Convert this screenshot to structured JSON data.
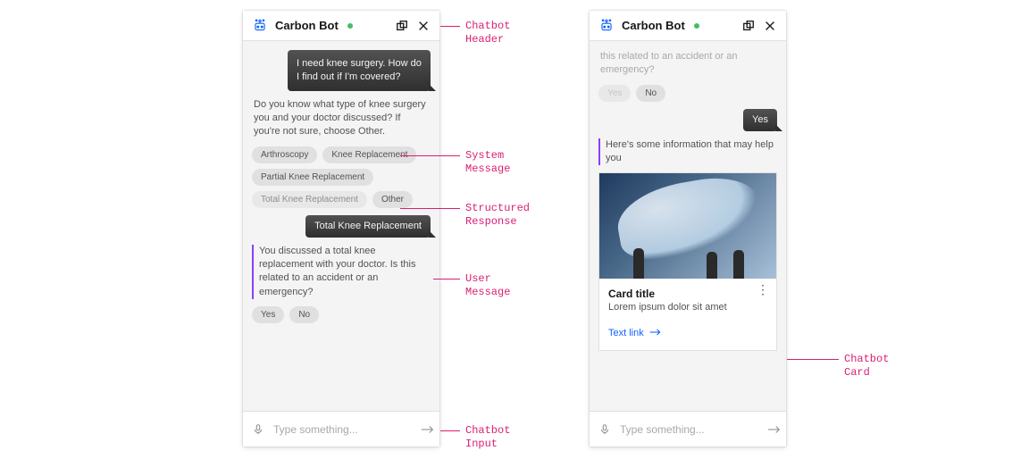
{
  "header": {
    "title": "Carbon Bot"
  },
  "left": {
    "user1": "I need knee surgery. How do I find out if I'm covered?",
    "sys1": "Do you know what type of knee surgery you and your doctor discussed? If you're not sure, choose Other.",
    "chips": {
      "c0": "Arthroscopy",
      "c1": "Knee Replacement",
      "c2": "Partial Knee Replacement",
      "c3": "Total Knee Replacement",
      "c4": "Other"
    },
    "user2": "Total Knee Replacement",
    "sys2": "You discussed a total knee replacement with your doctor. Is this related to an accident or an emergency?",
    "yn": {
      "yes": "Yes",
      "no": "No"
    }
  },
  "right": {
    "faded_tail": "this related to an accident or an emergency?",
    "yn": {
      "yes": "Yes",
      "no": "No"
    },
    "user_yes": "Yes",
    "sys": "Here's some information that may help you",
    "card": {
      "title": "Card title",
      "subtitle": "Lorem ipsum dolor sit amet",
      "link": "Text link"
    }
  },
  "input": {
    "placeholder": "Type something..."
  },
  "annotations": {
    "header": "Chatbot\nHeader",
    "system": "System\nMessage",
    "structured": "Structured\nResponse",
    "user": "User\nMessage",
    "input": "Chatbot\nInput",
    "card": "Chatbot\nCard"
  }
}
